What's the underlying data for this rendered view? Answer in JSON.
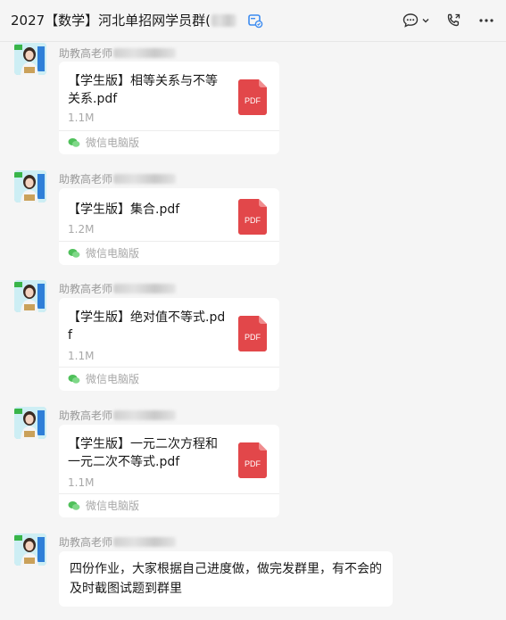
{
  "header": {
    "title": "2027【数学】河北单招网学员群(",
    "title_suffix": "",
    "icons": [
      "chat-bubble-icon",
      "chevron-down-icon",
      "phone-call-icon",
      "more-icon"
    ]
  },
  "messages": [
    {
      "sender": "助教高老师",
      "type": "file",
      "file_name": "【学生版】相等关系与不等关系.pdf",
      "file_size": "1.1M",
      "file_type": "PDF",
      "source": "微信电脑版"
    },
    {
      "sender": "助教高老师",
      "type": "file",
      "file_name": "【学生版】集合.pdf",
      "file_size": "1.2M",
      "file_type": "PDF",
      "source": "微信电脑版"
    },
    {
      "sender": "助教高老师",
      "type": "file",
      "file_name": "【学生版】绝对值不等式.pdf",
      "file_size": "1.1M",
      "file_type": "PDF",
      "source": "微信电脑版"
    },
    {
      "sender": "助教高老师",
      "type": "file",
      "file_name": "【学生版】一元二次方程和一元二次不等式.pdf",
      "file_size": "1.1M",
      "file_type": "PDF",
      "source": "微信电脑版"
    },
    {
      "sender": "助教高老师",
      "type": "text",
      "text": "四份作业，大家根据自己进度做，做完发群里，有不会的及时截图试题到群里"
    }
  ],
  "colors": {
    "background": "#f5f5f5",
    "bubble": "#ffffff",
    "pdf_red": "#e2474a",
    "wechat_green": "#4fc05a"
  }
}
